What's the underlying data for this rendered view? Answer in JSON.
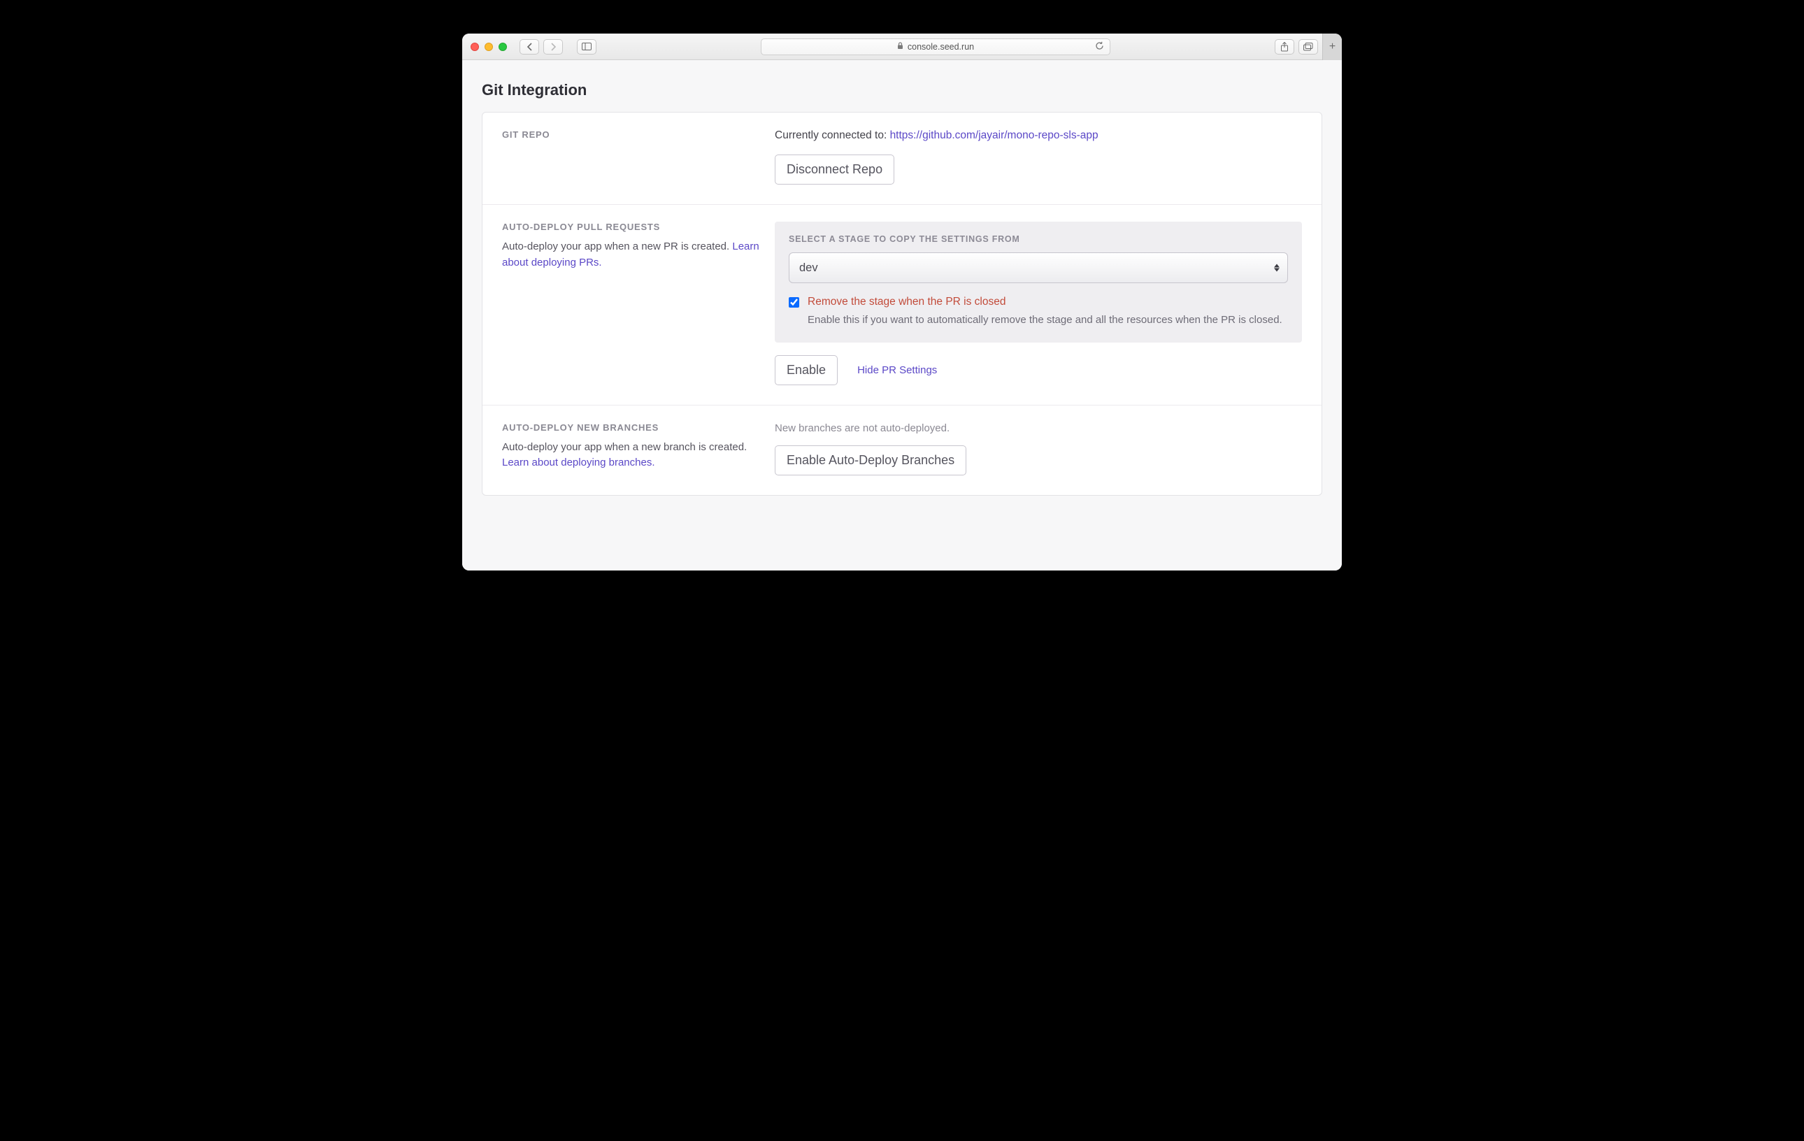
{
  "browser": {
    "url": "console.seed.run"
  },
  "page": {
    "title": "Git Integration"
  },
  "git_repo": {
    "eyebrow": "GIT REPO",
    "connected_prefix": "Currently connected to: ",
    "repo_url": "https://github.com/jayair/mono-repo-sls-app",
    "disconnect_label": "Disconnect Repo"
  },
  "pr": {
    "eyebrow": "AUTO-DEPLOY PULL REQUESTS",
    "desc_prefix": "Auto-deploy your app when a new PR is created. ",
    "learn_link": "Learn about deploying PRs.",
    "settings_label": "SELECT A STAGE TO COPY THE SETTINGS FROM",
    "selected_stage": "dev",
    "remove_label": "Remove the stage when the PR is closed",
    "remove_desc": "Enable this if you want to automatically remove the stage and all the resources when the PR is closed.",
    "enable_label": "Enable",
    "hide_link": "Hide PR Settings"
  },
  "branches": {
    "eyebrow": "AUTO-DEPLOY NEW BRANCHES",
    "desc_prefix": "Auto-deploy your app when a new branch is created. ",
    "learn_link": "Learn about deploying branches.",
    "status": "New branches are not auto-deployed.",
    "enable_label": "Enable Auto-Deploy Branches"
  }
}
